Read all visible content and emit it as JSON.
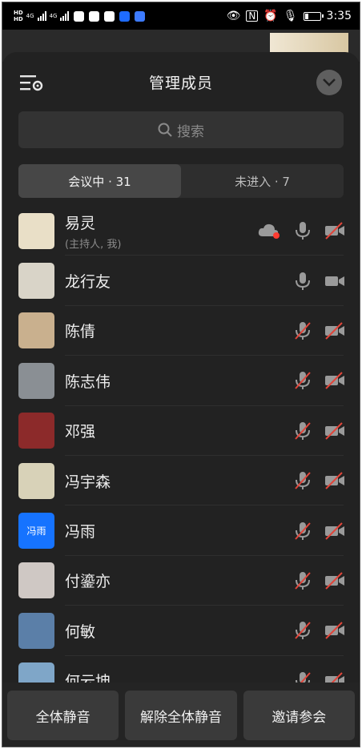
{
  "status_bar": {
    "hd1": "HD",
    "hd2": "HD",
    "net1": "4G",
    "net2": "4G",
    "time": "3:35"
  },
  "sheet": {
    "title": "管理成员",
    "search_placeholder": "搜索",
    "tabs": [
      {
        "label": "会议中 · 31",
        "active": true
      },
      {
        "label": "未进入 · 7",
        "active": false
      }
    ]
  },
  "members": [
    {
      "name": "易灵",
      "sub": "(主持人, 我)",
      "avatar_color": "#e9dfc7",
      "mic": "on",
      "cam": "off",
      "cloud": true
    },
    {
      "name": "龙行友",
      "sub": "",
      "avatar_color": "#d9d4c8",
      "mic": "on",
      "cam": "on",
      "cloud": false
    },
    {
      "name": "陈倩",
      "sub": "",
      "avatar_color": "#c9b08e",
      "mic": "off",
      "cam": "off",
      "cloud": false
    },
    {
      "name": "陈志伟",
      "sub": "",
      "avatar_color": "#8a8f94",
      "mic": "off",
      "cam": "off",
      "cloud": false
    },
    {
      "name": "邓强",
      "sub": "",
      "avatar_color": "#8c2a2a",
      "mic": "off",
      "cam": "off",
      "cloud": false
    },
    {
      "name": "冯宇森",
      "sub": "",
      "avatar_color": "#d8d2b8",
      "mic": "off",
      "cam": "off",
      "cloud": false
    },
    {
      "name": "冯雨",
      "sub": "",
      "avatar_text": "冯雨",
      "avatar_color": "#1673ff",
      "mic": "off",
      "cam": "off",
      "cloud": false
    },
    {
      "name": "付鎏亦",
      "sub": "",
      "avatar_color": "#cfc8c4",
      "mic": "off",
      "cam": "off",
      "cloud": false
    },
    {
      "name": "何敏",
      "sub": "",
      "avatar_color": "#5b7fa8",
      "mic": "off",
      "cam": "off",
      "cloud": false
    },
    {
      "name": "何云坤",
      "sub": "",
      "avatar_color": "#7fa6c8",
      "mic": "off",
      "cam": "off",
      "cloud": false
    }
  ],
  "footer": {
    "mute_all": "全体静音",
    "unmute_all": "解除全体静音",
    "invite": "邀请参会"
  },
  "colors": {
    "background": "#222222",
    "muted_red": "#e0453a",
    "recording_dot": "#ff3b30"
  }
}
